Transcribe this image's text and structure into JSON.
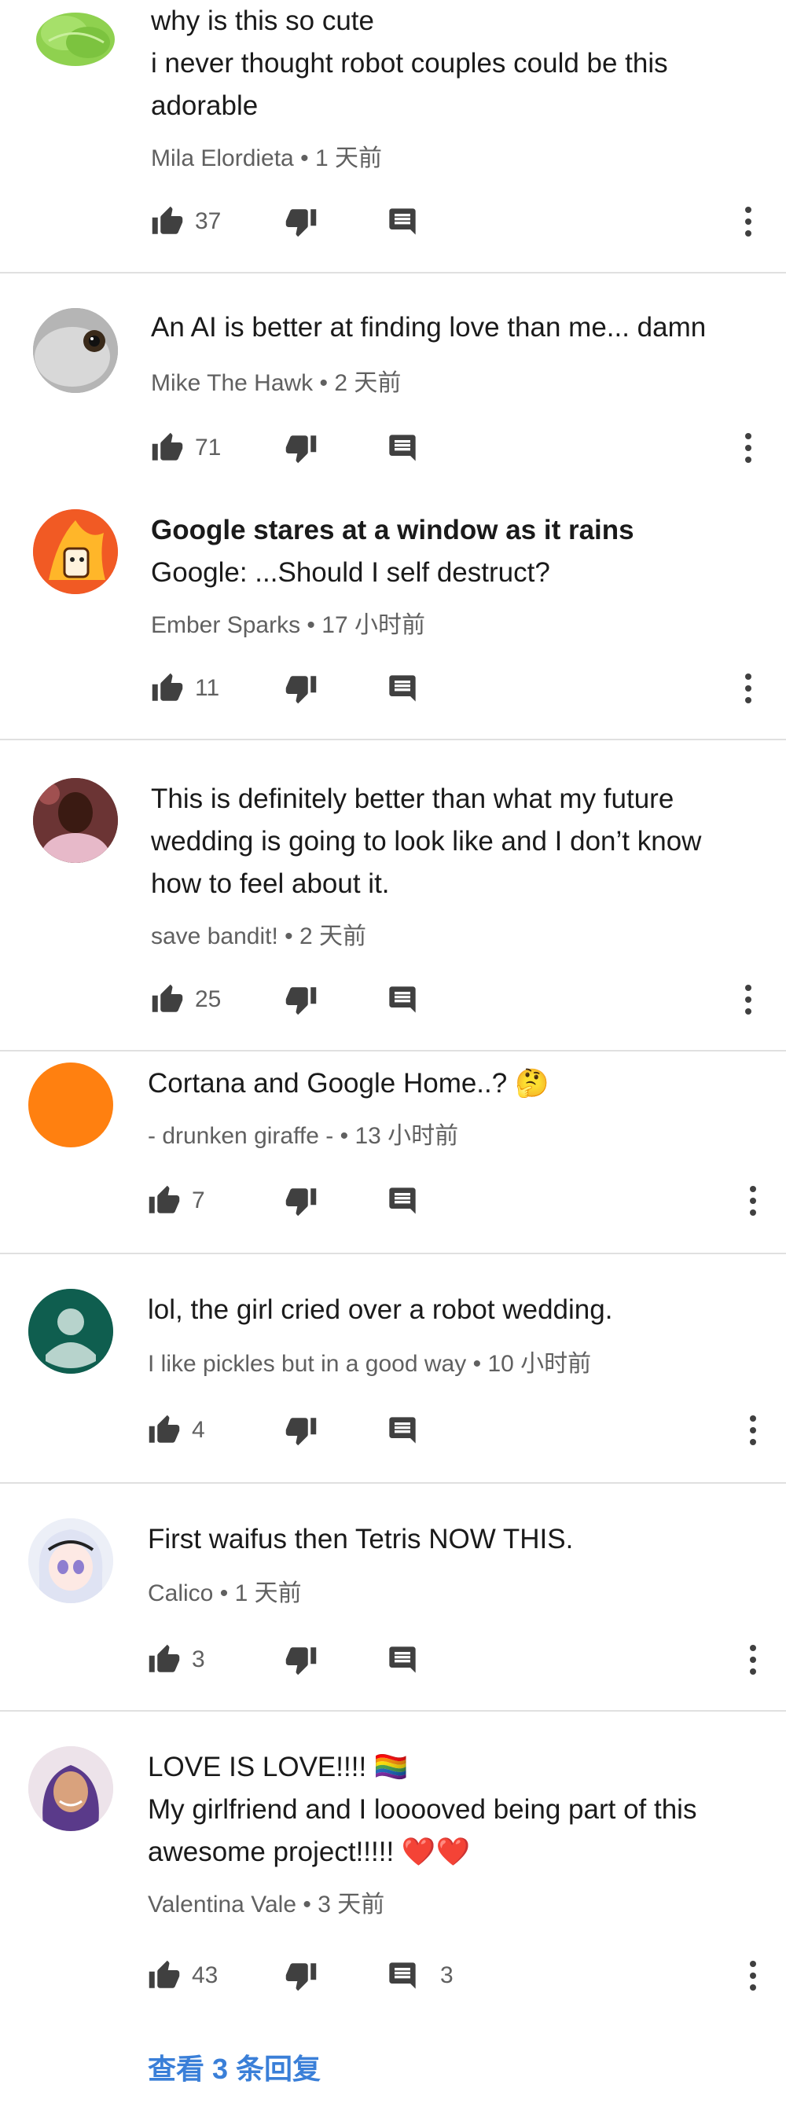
{
  "comments": [
    {
      "lines": [
        "why is this so cute",
        "i never thought robot couples could be this",
        "adorable"
      ],
      "author": "Mila Elordieta",
      "time": "1 天前",
      "likes": "37"
    },
    {
      "lines": [
        "An AI is better at finding love than me... damn"
      ],
      "author": "Mike The Hawk",
      "time": "2 天前",
      "likes": "71"
    },
    {
      "lines": [
        "Google stares at a window as it rains",
        "Google: ...Should I self destruct?"
      ],
      "author": "Ember Sparks",
      "time": "17 小时前",
      "likes": "11"
    },
    {
      "lines": [
        "This is definitely better than what my future",
        "wedding is going to look like and I don’t know",
        "how to feel about it."
      ],
      "author": "save bandit!",
      "time": "2 天前",
      "likes": "25"
    },
    {
      "lines": [
        "Cortana and Google Home..? 🤔"
      ],
      "author": "- drunken giraffe -",
      "time": "13 小时前",
      "likes": "7"
    },
    {
      "lines": [
        "lol, the girl cried over a robot wedding."
      ],
      "author": "I like pickles but in a good way",
      "time": "10 小时前",
      "likes": "4"
    },
    {
      "lines": [
        "First waifus then Tetris NOW THIS."
      ],
      "author": "Calico",
      "time": "1 天前",
      "likes": "3"
    },
    {
      "lines": [
        "LOVE IS LOVE!!!! 🏳️‍🌈",
        "My girlfriend and I looooved being part of this",
        "awesome project!!!!! ❤️❤️"
      ],
      "author": "Valentina Vale",
      "time": "3 天前",
      "likes": "43",
      "replies": "3"
    }
  ],
  "separator": "•",
  "view_replies": "查看 3 条回复",
  "colors": {
    "accent": "#3a7fd8",
    "meta": "#606060",
    "icon": "#404040",
    "divider": "#e0e0e0"
  },
  "icons": [
    "like-icon",
    "dislike-icon",
    "reply-icon",
    "more-vert-icon"
  ]
}
